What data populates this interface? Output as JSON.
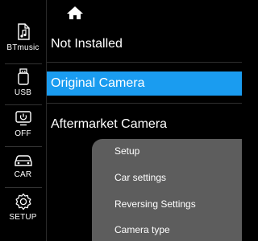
{
  "sidebar": {
    "items": [
      {
        "label": "BTmusic",
        "icon": "music-file-icon"
      },
      {
        "label": "USB",
        "icon": "usb-icon"
      },
      {
        "label": "OFF",
        "icon": "power-off-icon"
      },
      {
        "label": "CAR",
        "icon": "car-icon"
      },
      {
        "label": "SETUP",
        "icon": "gear-icon"
      }
    ]
  },
  "header": {
    "home_icon": "home-icon"
  },
  "options": [
    {
      "label": "Not Installed",
      "selected": false
    },
    {
      "label": "Original Camera",
      "selected": true
    },
    {
      "label": "Aftermarket Camera",
      "selected": false
    }
  ],
  "menu": {
    "items": [
      {
        "label": "Setup"
      },
      {
        "label": "Car settings"
      },
      {
        "label": "Reversing Settings"
      },
      {
        "label": "Camera type"
      }
    ]
  },
  "colors": {
    "accent": "#1a9cf0",
    "background": "#000000",
    "menu_bg": "#646464"
  }
}
